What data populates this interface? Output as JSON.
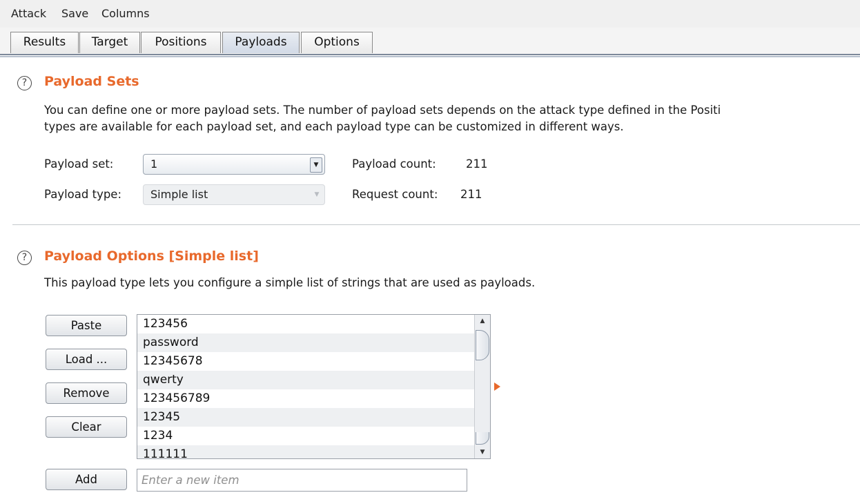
{
  "menu": {
    "items": [
      "Attack",
      "Save",
      "Columns"
    ]
  },
  "tabs": [
    {
      "label": "Results"
    },
    {
      "label": "Target"
    },
    {
      "label": "Positions"
    },
    {
      "label": "Payloads",
      "active": true
    },
    {
      "label": "Options"
    }
  ],
  "payload_sets": {
    "title": "Payload Sets",
    "desc_line1": "You can define one or more payload sets. The number of payload sets depends on the attack type defined in the Positi",
    "desc_line2": "types are available for each payload set, and each payload type can be customized in different ways.",
    "set_label": "Payload set:",
    "set_value": "1",
    "type_label": "Payload type:",
    "type_value": "Simple list",
    "payload_count_label": "Payload count:",
    "payload_count": "211",
    "request_count_label": "Request count:",
    "request_count": "211"
  },
  "payload_options": {
    "title": "Payload Options [Simple list]",
    "desc": "This payload type lets you configure a simple list of strings that are used as payloads.",
    "buttons": {
      "paste": "Paste",
      "load": "Load ...",
      "remove": "Remove",
      "clear": "Clear",
      "add": "Add"
    },
    "items": [
      "123456",
      "password",
      "12345678",
      "qwerty",
      "123456789",
      "12345",
      "1234",
      "111111"
    ],
    "add_placeholder": "Enter a new item"
  },
  "icons": {
    "help": "help-circle-icon",
    "dropdown": "chevron-down-icon",
    "expand": "triangle-right-icon"
  },
  "colors": {
    "accent": "#e8692c",
    "tab_active": "#d2dae6"
  }
}
